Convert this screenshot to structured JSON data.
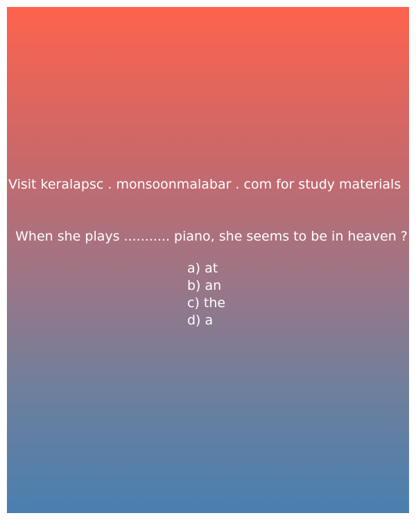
{
  "promo": {
    "text": "Visit keralapsc . monsoonmalabar . com for study materials"
  },
  "question": {
    "text": "When she plays ........... piano, she seems to be in heaven ?"
  },
  "options": [
    {
      "label": "a) at"
    },
    {
      "label": "b) an"
    },
    {
      "label": "c) the"
    },
    {
      "label": "d) a"
    }
  ],
  "colors": {
    "gradient_top": "#fe634d",
    "gradient_bottom": "#4a7fb0",
    "text": "#ffffff"
  }
}
